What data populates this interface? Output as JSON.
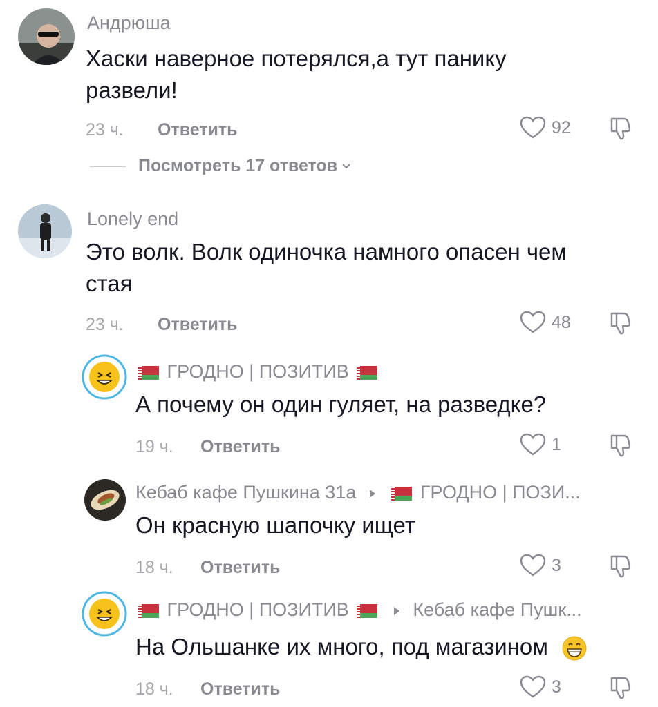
{
  "comments": [
    {
      "author": "Андрюша",
      "text_line1": "Хаски наверное потерялся,а тут панику",
      "text_line2": "развели!",
      "time": "23 ч.",
      "reply_label": "Ответить",
      "likes": "92",
      "view_replies": "Посмотреть 17 ответов"
    },
    {
      "author": "Lonely end",
      "text_line1": "Это волк. Волк одиночка намного опасен чем",
      "text_line2": "стая",
      "time": "23 ч.",
      "reply_label": "Ответить",
      "likes": "48"
    }
  ],
  "replies": [
    {
      "author": "ГРОДНО | ПОЗИТИВ",
      "text": "А почему он один гуляет, на разведке?",
      "time": "19 ч.",
      "reply_label": "Ответить",
      "likes": "1"
    },
    {
      "author": "Кебаб кафе Пушкина 31а",
      "reply_to": "ГРОДНО | ПОЗИ...",
      "text": "Он красную шапочку ищет",
      "time": "18 ч.",
      "reply_label": "Ответить",
      "likes": "3"
    },
    {
      "author": "ГРОДНО | ПОЗИТИВ",
      "reply_to": "Кебаб кафе Пушк...",
      "text": "На Ольшанке их много, под магазином",
      "time": "18 ч.",
      "reply_label": "Ответить",
      "likes": "3"
    }
  ],
  "icons": {
    "like": "heart-outline-icon",
    "dislike": "thumbs-down-icon",
    "emoji": "grinning-face-emoji"
  },
  "colors": {
    "text": "#161823",
    "muted": "#8a8b91",
    "flag_red": "#c8313e",
    "flag_green": "#4aa657"
  }
}
